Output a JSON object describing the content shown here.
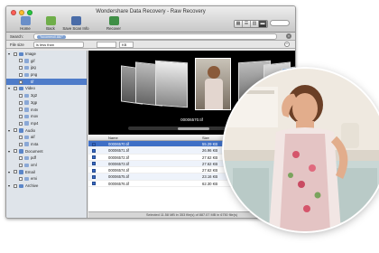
{
  "window": {
    "title": "Wondershare Data Recovery - Raw Recovery",
    "toolbar": [
      {
        "label": "Home",
        "icon": "home-icon",
        "color": "#6a8fc9"
      },
      {
        "label": "Back",
        "icon": "back-arrow-icon",
        "color": "#6fae4a"
      },
      {
        "label": "Save Scan Info",
        "icon": "save-icon",
        "color": "#4a6ca8"
      },
      {
        "label": "Recover",
        "icon": "recover-icon",
        "color": "#3f8f46"
      }
    ],
    "views": [
      "▦",
      "☰",
      "▥",
      "▬"
    ]
  },
  "search": {
    "label": "Search:",
    "token": "\"tocomeroll.887\""
  },
  "filter": {
    "label": "File size",
    "mode": "is less than",
    "value": "",
    "unit": "KB"
  },
  "tree": [
    {
      "label": "Image",
      "level": 0,
      "icon": "folder-icon",
      "color": "#5b86c8"
    },
    {
      "label": "gif",
      "level": 1,
      "icon": "file-icon",
      "color": "#8aa8d6"
    },
    {
      "label": "jpg",
      "level": 1,
      "icon": "file-icon",
      "color": "#8aa8d6"
    },
    {
      "label": "png",
      "level": 1,
      "icon": "file-icon",
      "color": "#8aa8d6"
    },
    {
      "label": "tif",
      "level": 1,
      "icon": "file-icon",
      "color": "#4b7dd0",
      "selected": true
    },
    {
      "label": "Video",
      "level": 0,
      "icon": "folder-icon",
      "color": "#5b86c8"
    },
    {
      "label": "3g2",
      "level": 1,
      "icon": "file-icon",
      "color": "#8aa8d6"
    },
    {
      "label": "3gp",
      "level": 1,
      "icon": "file-icon",
      "color": "#8aa8d6"
    },
    {
      "label": "m4v",
      "level": 1,
      "icon": "file-icon",
      "color": "#8aa8d6"
    },
    {
      "label": "mov",
      "level": 1,
      "icon": "file-icon",
      "color": "#8aa8d6"
    },
    {
      "label": "mp4",
      "level": 1,
      "icon": "file-icon",
      "color": "#8aa8d6"
    },
    {
      "label": "Audio",
      "level": 0,
      "icon": "folder-icon",
      "color": "#5b86c8"
    },
    {
      "label": "aif",
      "level": 1,
      "icon": "file-icon",
      "color": "#8aa8d6"
    },
    {
      "label": "m4a",
      "level": 1,
      "icon": "file-icon",
      "color": "#8aa8d6"
    },
    {
      "label": "Document",
      "level": 0,
      "icon": "folder-icon",
      "color": "#5b86c8"
    },
    {
      "label": "pdf",
      "level": 1,
      "icon": "file-icon",
      "color": "#8aa8d6"
    },
    {
      "label": "xml",
      "level": 1,
      "icon": "file-icon",
      "color": "#8aa8d6"
    },
    {
      "label": "Email",
      "level": 0,
      "icon": "folder-icon",
      "color": "#5b86c8"
    },
    {
      "label": "emi",
      "level": 1,
      "icon": "file-icon",
      "color": "#8aa8d6"
    },
    {
      "label": "Archive",
      "level": 0,
      "icon": "folder-icon",
      "color": "#5b86c8"
    }
  ],
  "preview": {
    "caption": "00006570.tif"
  },
  "list": {
    "headers": {
      "name": "Name",
      "size": "Size"
    },
    "rows": [
      {
        "name": "00006570.tif",
        "size": "55.29 KB",
        "selected": true
      },
      {
        "name": "00006571.tif",
        "size": "26.96 KB"
      },
      {
        "name": "00006572.tif",
        "size": "27.62 KB"
      },
      {
        "name": "00006573.tif",
        "size": "27.62 KB"
      },
      {
        "name": "00006574.tif",
        "size": "27.62 KB"
      },
      {
        "name": "00006575.tif",
        "size": "23.16 KB"
      },
      {
        "name": "00006576.tif",
        "size": "62.30 KB"
      }
    ]
  },
  "status": "Selected 11.58 MB in 353 file(s) of 887.07 MB in 6750 file(s)",
  "photo": {
    "description_icon": "woman-in-apron-photo"
  }
}
